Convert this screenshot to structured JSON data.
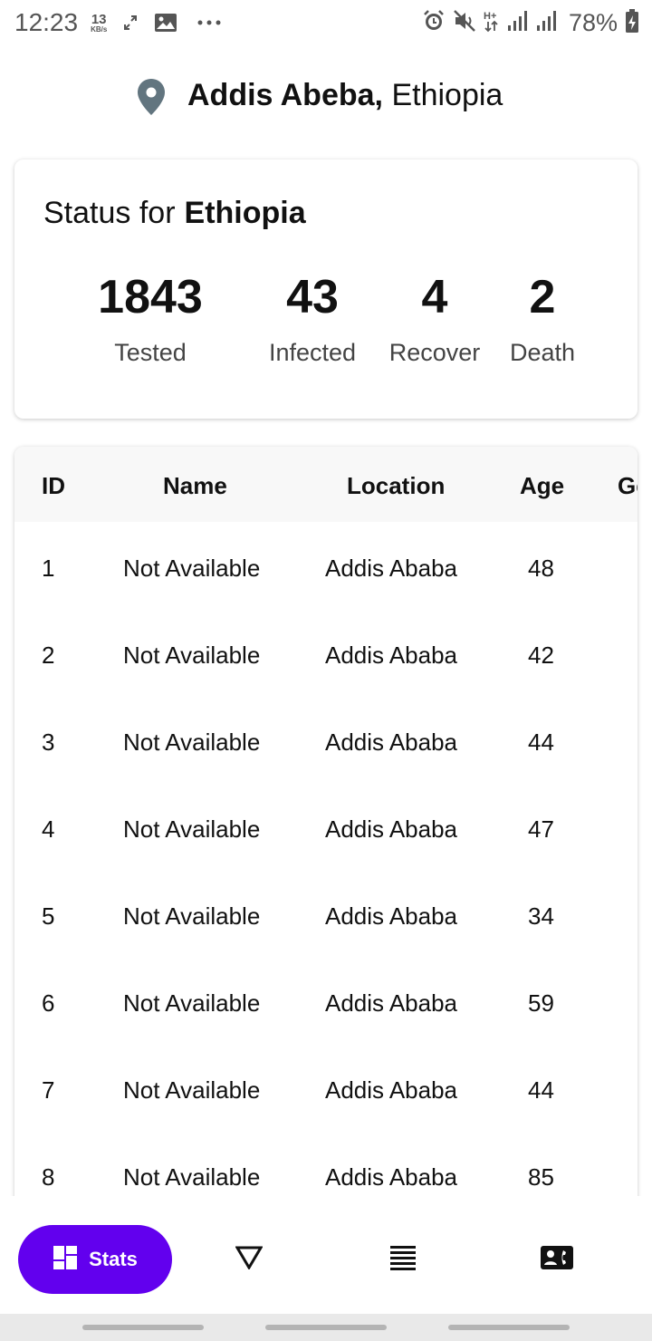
{
  "status_bar": {
    "time": "12:23",
    "net_speed_value": "13",
    "net_speed_unit": "KB/s",
    "battery": "78%",
    "icons": [
      "expand-icon",
      "image-icon",
      "more-icon",
      "alarm-icon",
      "mute-icon",
      "hplus-icon",
      "signal-icon",
      "signal-icon",
      "battery-charging-icon"
    ]
  },
  "header": {
    "city": "Addis Abeba,",
    "country": "Ethiopia",
    "icons": [
      "location-pin-icon",
      "moon-icon"
    ]
  },
  "status_card": {
    "title_prefix": "Status for",
    "title_country": "Ethiopia",
    "stats": [
      {
        "value": "1843",
        "label": "Tested"
      },
      {
        "value": "43",
        "label": "Infected"
      },
      {
        "value": "4",
        "label": "Recover"
      },
      {
        "value": "2",
        "label": "Death"
      }
    ]
  },
  "table": {
    "headers": [
      "ID",
      "Name",
      "Location",
      "Age",
      "Gender"
    ],
    "rows": [
      {
        "id": "1",
        "name": "Not Available",
        "location": "Addis Ababa",
        "age": "48"
      },
      {
        "id": "2",
        "name": "Not Available",
        "location": "Addis Ababa",
        "age": "42"
      },
      {
        "id": "3",
        "name": "Not Available",
        "location": "Addis Ababa",
        "age": "44"
      },
      {
        "id": "4",
        "name": "Not Available",
        "location": "Addis Ababa",
        "age": "47"
      },
      {
        "id": "5",
        "name": "Not Available",
        "location": "Addis Ababa",
        "age": "34"
      },
      {
        "id": "6",
        "name": "Not Available",
        "location": "Addis Ababa",
        "age": "59"
      },
      {
        "id": "7",
        "name": "Not Available",
        "location": "Addis Ababa",
        "age": "44"
      },
      {
        "id": "8",
        "name": "Not Available",
        "location": "Addis Ababa",
        "age": "85"
      }
    ]
  },
  "bottom_nav": {
    "active_label": "Stats",
    "accent_color": "#6200ee",
    "items": [
      "dashboard-icon",
      "filter-triangle-icon",
      "list-icon",
      "contact-phone-icon"
    ]
  }
}
